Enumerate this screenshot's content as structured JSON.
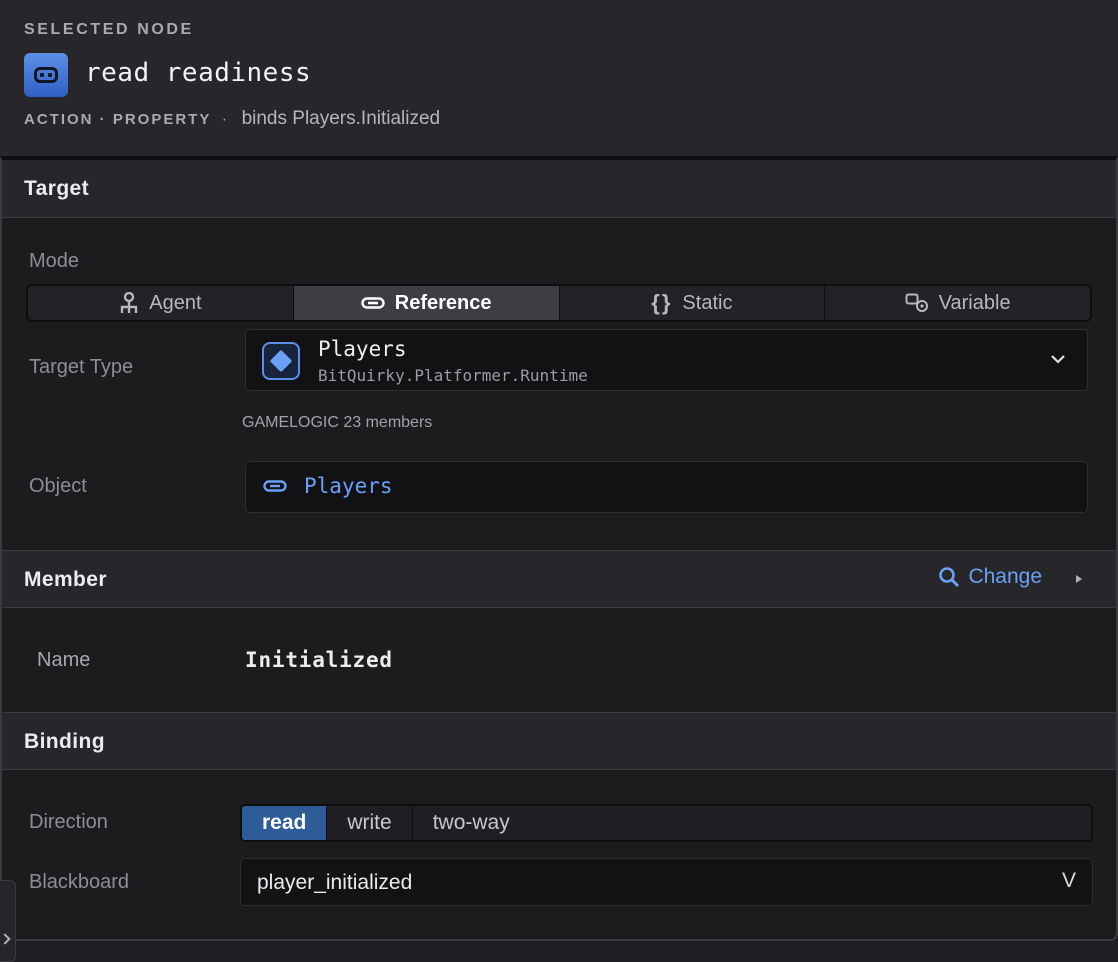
{
  "header": {
    "eyebrow": "SELECTED NODE",
    "node_title": "read readiness",
    "kind": "ACTION · PROPERTY",
    "separator": "·",
    "binds": "binds Players.Initialized",
    "icon": "property-node-icon"
  },
  "target": {
    "title": "Target",
    "mode_label": "Mode",
    "modes": [
      {
        "label": "Agent",
        "icon": "agent-icon",
        "active": false
      },
      {
        "label": "Reference",
        "icon": "link-icon",
        "active": true
      },
      {
        "label": "Static",
        "icon": "braces-icon",
        "active": false
      },
      {
        "label": "Variable",
        "icon": "variable-icon",
        "active": false
      }
    ],
    "target_type_label": "Target Type",
    "target_type_name": "Players",
    "target_type_namespace": "BitQuirky.Platformer.Runtime",
    "members_info": "GAMELOGIC 23 members",
    "object_label": "Object",
    "object_value": "Players"
  },
  "member": {
    "title": "Member",
    "change_label": "Change",
    "name_label": "Name",
    "name_value": "Initialized"
  },
  "binding": {
    "title": "Binding",
    "direction_label": "Direction",
    "directions": [
      {
        "label": "read",
        "active": true
      },
      {
        "label": "write",
        "active": false
      },
      {
        "label": "two-way",
        "active": false
      }
    ],
    "blackboard_label": "Blackboard",
    "blackboard_value": "player_initialized",
    "blackboard_chevron": "V"
  },
  "colors": {
    "accent": "#6aa0f5",
    "active_direction": "#2e5c97"
  }
}
